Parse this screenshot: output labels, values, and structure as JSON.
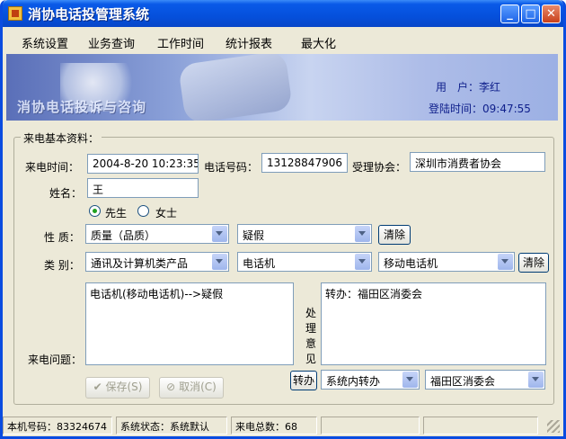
{
  "window": {
    "title": "消协电话投管理系统"
  },
  "menu": [
    "系统设置",
    "业务查询",
    "工作时间",
    "统计报表",
    "最大化"
  ],
  "banner": {
    "slogan": "消协电话投诉与咨询",
    "user_label": "用　户：",
    "user_value": "李红",
    "login_label": "登陆时间：",
    "login_value": "09:47:55"
  },
  "form": {
    "group_title": "来电基本资料：",
    "call_time_label": "来电时间：",
    "call_time_value": "2004-8-20 10:23:35",
    "phone_label": "电话号码：",
    "phone_value": "13128847906",
    "association_label": "受理协会：",
    "association_value": "深圳市消费者协会",
    "name_label": "姓名：",
    "name_value": "王",
    "gender_male": "先生",
    "gender_female": "女士",
    "nature_label": "性 质：",
    "nature_sel1": "质量（品质）",
    "nature_sel2": "疑假",
    "clear_label": "清除",
    "category_label": "类 别：",
    "category_sel1": "通讯及计算机类产品",
    "category_sel2": "电话机",
    "category_sel3": "移动电话机",
    "issue_label": "来电问题：",
    "issue_text": "电话机(移动电话机)-->疑假",
    "opinion_label": "处理意见",
    "opinion_text": "转办：福田区消委会",
    "save_label": "保存(S)",
    "cancel_label": "取消(C)",
    "transfer_label": "转办",
    "transfer_sel1": "系统内转办",
    "transfer_sel2": "福田区消委会"
  },
  "status": {
    "machine": "本机号码：83324674",
    "state": "系统状态：系统默认",
    "total": "来电总数：68"
  }
}
